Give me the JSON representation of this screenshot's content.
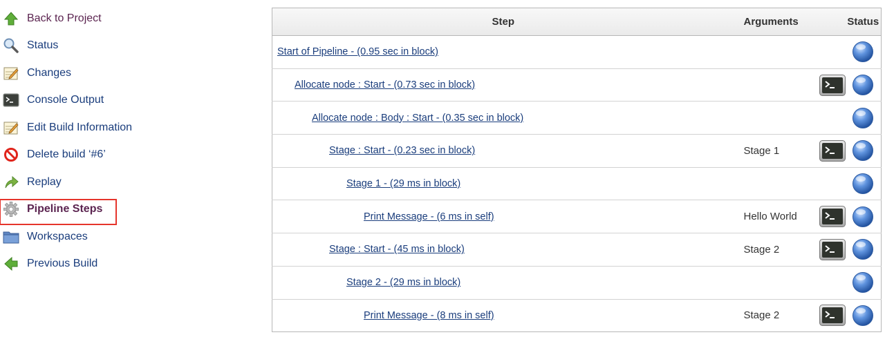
{
  "sidebar": {
    "items": [
      {
        "label": "Back to Project",
        "icon": "up-arrow-icon",
        "state": "visited"
      },
      {
        "label": "Status",
        "icon": "magnifier-icon",
        "state": "normal"
      },
      {
        "label": "Changes",
        "icon": "notepad-icon",
        "state": "normal"
      },
      {
        "label": "Console Output",
        "icon": "terminal-icon",
        "state": "normal"
      },
      {
        "label": "Edit Build Information",
        "icon": "notepad-icon",
        "state": "normal"
      },
      {
        "label": "Delete build ‘#6’",
        "icon": "no-entry-icon",
        "state": "normal"
      },
      {
        "label": "Replay",
        "icon": "replay-arrow-icon",
        "state": "normal"
      },
      {
        "label": "Pipeline Steps",
        "icon": "gear-icon",
        "state": "selected"
      },
      {
        "label": "Workspaces",
        "icon": "folder-icon",
        "state": "normal"
      },
      {
        "label": "Previous Build",
        "icon": "left-arrow-icon",
        "state": "normal"
      }
    ]
  },
  "table": {
    "headers": {
      "step": "Step",
      "arguments": "Arguments",
      "status": "Status"
    },
    "rows": [
      {
        "step": "Start of Pipeline - (0.95 sec in block)",
        "indent": 0,
        "arguments": "",
        "console": false,
        "status": "success"
      },
      {
        "step": "Allocate node : Start - (0.73 sec in block)",
        "indent": 1,
        "arguments": "",
        "console": true,
        "status": "success"
      },
      {
        "step": "Allocate node : Body : Start - (0.35 sec in block)",
        "indent": 2,
        "arguments": "",
        "console": false,
        "status": "success"
      },
      {
        "step": "Stage : Start - (0.23 sec in block)",
        "indent": 3,
        "arguments": "Stage 1",
        "console": true,
        "status": "success"
      },
      {
        "step": "Stage 1 - (29 ms in block)",
        "indent": 4,
        "arguments": "",
        "console": false,
        "status": "success"
      },
      {
        "step": "Print Message - (6 ms in self)",
        "indent": 5,
        "arguments": "Hello World",
        "console": true,
        "status": "success"
      },
      {
        "step": "Stage : Start - (45 ms in block)",
        "indent": 3,
        "arguments": "Stage 2",
        "console": true,
        "status": "success"
      },
      {
        "step": "Stage 2 - (29 ms in block)",
        "indent": 4,
        "arguments": "",
        "console": false,
        "status": "success"
      },
      {
        "step": "Print Message - (8 ms in self)",
        "indent": 5,
        "arguments": "Stage 2",
        "console": true,
        "status": "success"
      }
    ]
  },
  "colors": {
    "link": "#1a3d7c",
    "visited_link": "#5b2450",
    "selected_border": "#e5342b",
    "status_success": "#4a7ed0"
  }
}
